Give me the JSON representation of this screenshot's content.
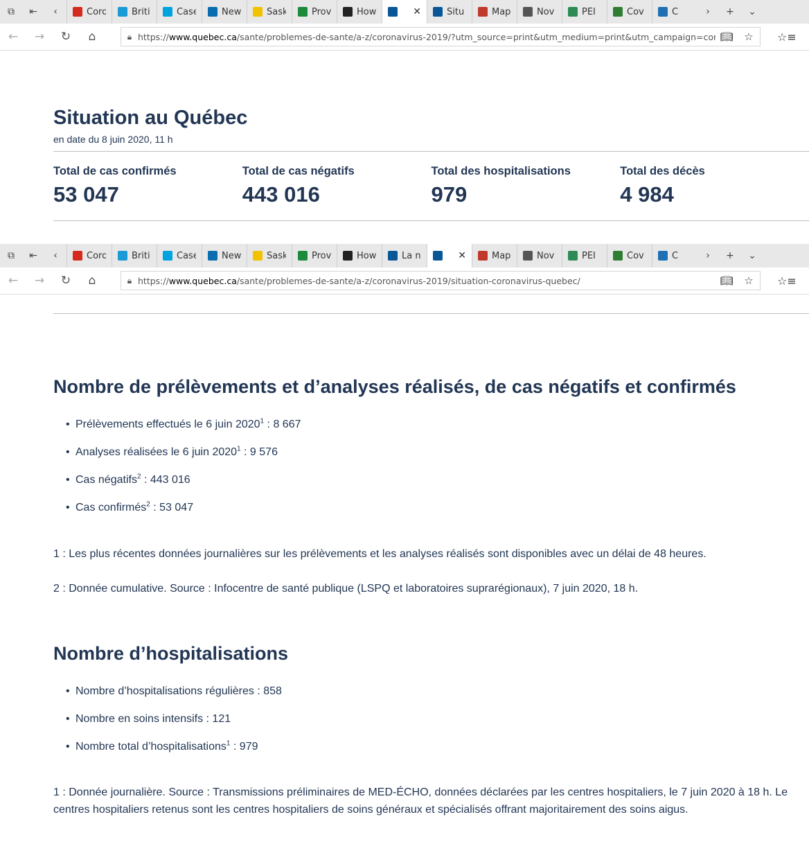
{
  "browser_top": {
    "tabs": [
      {
        "label": "Coro",
        "fav": "maple-leaf-icon",
        "color": "#d52b1e"
      },
      {
        "label": "Briti",
        "fav": "bc-icon",
        "color": "#1a9ad6"
      },
      {
        "label": "Case",
        "fav": "alberta-icon",
        "color": "#00a3e0"
      },
      {
        "label": "New",
        "fav": "nb-icon",
        "color": "#0a6db0"
      },
      {
        "label": "Sask",
        "fav": "sask-icon",
        "color": "#f2c200"
      },
      {
        "label": "Prov",
        "fav": "manitoba-icon",
        "color": "#1b8a3a"
      },
      {
        "label": "How",
        "fav": "shield-icon",
        "color": "#222222"
      },
      {
        "label": "",
        "fav": "quebec-fleur-icon",
        "color": "#095797",
        "active": true
      },
      {
        "label": "Situ",
        "fav": "quebec-fleur-icon",
        "color": "#095797"
      },
      {
        "label": "Map",
        "fav": "ontario-icon",
        "color": "#c0392b"
      },
      {
        "label": "Nov",
        "fav": "ns-icon",
        "color": "#555555"
      },
      {
        "label": "PEI",
        "fav": "pei-icon",
        "color": "#2e8b57"
      },
      {
        "label": "Cov",
        "fav": "globe-icon",
        "color": "#2e7d32"
      },
      {
        "label": "C",
        "fav": "nl-icon",
        "color": "#1f6fb5"
      }
    ],
    "url_prefix": "https://",
    "url_domain": "www.quebec.ca",
    "url_path": "/sante/problemes-de-sante/a-z/coronavirus-2019/?utm_source=print&utm_medium=print&utm_campaign=coronavirus"
  },
  "browser_bottom": {
    "tabs": [
      {
        "label": "Coro",
        "fav": "maple-leaf-icon",
        "color": "#d52b1e"
      },
      {
        "label": "Briti",
        "fav": "bc-icon",
        "color": "#1a9ad6"
      },
      {
        "label": "Case",
        "fav": "alberta-icon",
        "color": "#00a3e0"
      },
      {
        "label": "New",
        "fav": "nb-icon",
        "color": "#0a6db0"
      },
      {
        "label": "Sask",
        "fav": "sask-icon",
        "color": "#f2c200"
      },
      {
        "label": "Prov",
        "fav": "manitoba-icon",
        "color": "#1b8a3a"
      },
      {
        "label": "How",
        "fav": "shield-icon",
        "color": "#222222"
      },
      {
        "label": "La n",
        "fav": "quebec-fleur-icon",
        "color": "#095797"
      },
      {
        "label": "",
        "fav": "quebec-fleur-icon",
        "color": "#095797",
        "active": true
      },
      {
        "label": "Map",
        "fav": "ontario-icon",
        "color": "#c0392b"
      },
      {
        "label": "Nov",
        "fav": "ns-icon",
        "color": "#555555"
      },
      {
        "label": "PEI",
        "fav": "pei-icon",
        "color": "#2e8b57"
      },
      {
        "label": "Cov",
        "fav": "globe-icon",
        "color": "#2e7d32"
      },
      {
        "label": "C",
        "fav": "nl-icon",
        "color": "#1f6fb5"
      }
    ],
    "url_prefix": "https://",
    "url_domain": "www.quebec.ca",
    "url_path": "/sante/problemes-de-sante/a-z/coronavirus-2019/situation-coronavirus-quebec/"
  },
  "situation": {
    "title": "Situation au Québec",
    "date": "en date du 8 juin 2020, 11 h",
    "stats": [
      {
        "label": "Total de cas confirmés",
        "value": "53 047"
      },
      {
        "label": "Total de cas négatifs",
        "value": "443 016"
      },
      {
        "label": "Total des hospitalisations",
        "value": "979"
      },
      {
        "label": "Total des décès",
        "value": "4 984"
      }
    ]
  },
  "tests": {
    "heading": "Nombre de prélèvements et d’analyses réalisés, de cas négatifs et confirmés",
    "items": [
      {
        "text": "Prélèvements effectués le 6 juin 2020",
        "sup": "1",
        "value": " : 8 667"
      },
      {
        "text": "Analyses réalisées le 6 juin 2020",
        "sup": "1",
        "value": " : 9 576"
      },
      {
        "text": "Cas négatifs",
        "sup": "2",
        "value": " : 443 016"
      },
      {
        "text": "Cas confirmés",
        "sup": "2",
        "value": " : 53 047"
      }
    ],
    "note1": "1 : Les plus récentes données journalières sur les prélèvements et les analyses réalisés sont disponibles avec un délai de 48 heures.",
    "note2": "2 : Donnée cumulative. Source : Infocentre de santé publique (LSPQ et laboratoires suprarégionaux), 7 juin 2020, 18 h."
  },
  "hosp": {
    "heading": "Nombre d’hospitalisations",
    "items": [
      {
        "text": "Nombre d’hospitalisations régulières : 858",
        "sup": "",
        "value": ""
      },
      {
        "text": "Nombre en soins intensifs : 121",
        "sup": "",
        "value": ""
      },
      {
        "text": "Nombre total d’hospitalisations",
        "sup": "1",
        "value": " : 979"
      }
    ],
    "note_line1": "1 : Donnée journalière. Source : Transmissions préliminaires de MED-ÉCHO, données déclarées par les centres hospitaliers, le 7 juin 2020 à 18 h. Le",
    "note_line2": "centres hospitaliers retenus sont les centres hospitaliers de soins généraux et spécialisés offrant majoritairement des soins aigus."
  }
}
